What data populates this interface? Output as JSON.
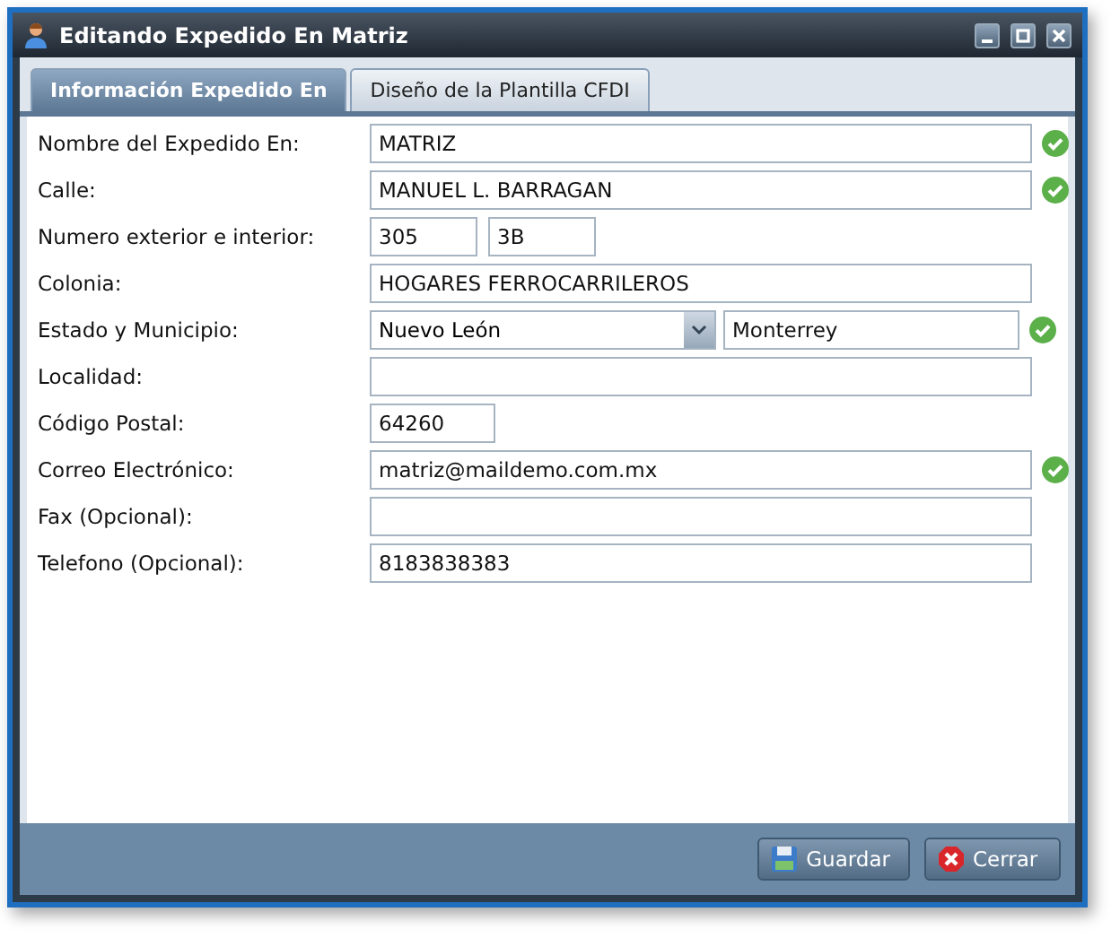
{
  "window": {
    "title": "Editando Expedido En Matriz"
  },
  "tabs": [
    {
      "label": "Información Expedido En",
      "selected": true
    },
    {
      "label": "Diseño de la Plantilla CFDI",
      "selected": false
    }
  ],
  "rows": [
    {
      "label": "Nombre del Expedido En:",
      "kind": "text",
      "values": [
        "MATRIZ"
      ],
      "valid": true
    },
    {
      "label": "Calle:",
      "kind": "text",
      "values": [
        "MANUEL L. BARRAGAN"
      ],
      "valid": true
    },
    {
      "label": "Numero exterior e interior:",
      "kind": "pair",
      "values": [
        "305",
        "3B"
      ],
      "valid": false
    },
    {
      "label": "Colonia:",
      "kind": "text",
      "values": [
        "HOGARES FERROCARRILEROS"
      ],
      "valid": false
    },
    {
      "label": "Estado y Municipio:",
      "kind": "select",
      "values": [
        "Nuevo León",
        "Monterrey"
      ],
      "valid": true
    },
    {
      "label": "Localidad:",
      "kind": "text",
      "values": [],
      "valid": false
    },
    {
      "label": "Código Postal:",
      "kind": "short",
      "values": [
        "64260"
      ],
      "valid": false
    },
    {
      "label": "Correo Electrónico:",
      "kind": "text",
      "values": [
        "matriz@maildemo.com.mx"
      ],
      "valid": true
    },
    {
      "label": "Fax (Opcional):",
      "kind": "text",
      "values": [],
      "valid": false
    },
    {
      "label": "Telefono (Opcional):",
      "kind": "text",
      "values": [
        "8183838383"
      ],
      "valid": false
    }
  ],
  "buttons": [
    {
      "label": "Guardar",
      "kind": "save"
    },
    {
      "label": "Cerrar",
      "kind": "close"
    }
  ]
}
